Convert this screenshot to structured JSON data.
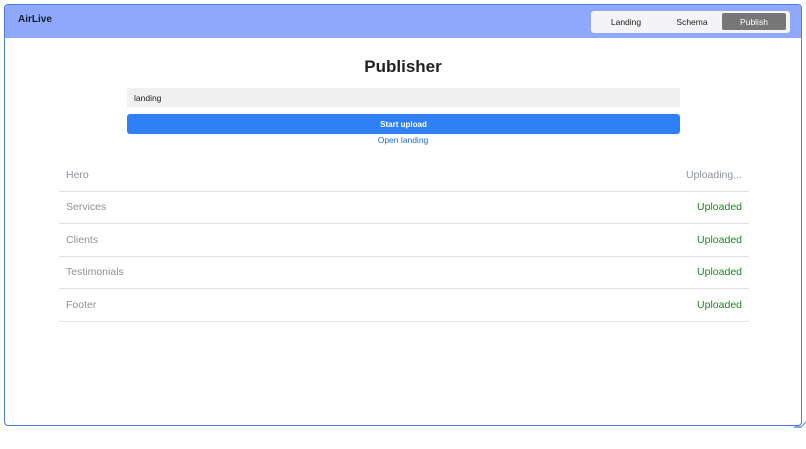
{
  "app": {
    "brand": "AirLive"
  },
  "nav": {
    "tabs": [
      {
        "label": "Landing",
        "active": false
      },
      {
        "label": "Schema",
        "active": false
      },
      {
        "label": "Publish",
        "active": true
      }
    ]
  },
  "main": {
    "title": "Publisher",
    "input_value": "landing",
    "upload_button_label": "Start upload",
    "open_link_label": "Open landing"
  },
  "sections": [
    {
      "name": "Hero",
      "status": "Uploading..."
    },
    {
      "name": "Services",
      "status": "Uploaded"
    },
    {
      "name": "Clients",
      "status": "Uploaded"
    },
    {
      "name": "Testimonials",
      "status": "Uploaded"
    },
    {
      "name": "Footer",
      "status": "Uploaded"
    }
  ],
  "colors": {
    "navbar": "#8fa8fb",
    "accent": "#2f7ff5",
    "success": "#1a8a1a",
    "muted": "#8c939b"
  }
}
